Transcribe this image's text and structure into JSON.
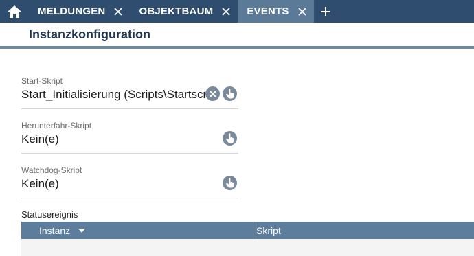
{
  "tabs": [
    {
      "label": "MELDUNGEN",
      "active": false
    },
    {
      "label": "OBJEKTBAUM",
      "active": false
    },
    {
      "label": "EVENTS",
      "active": true
    }
  ],
  "page_title": "Instanzkonfiguration",
  "fields": {
    "start": {
      "label": "Start-Skript",
      "value": "Start_Initialisierung (Scripts\\Startscript)"
    },
    "shutdown": {
      "label": "Herunterfahr-Skript",
      "value": "Kein(e)"
    },
    "watchdog": {
      "label": "Watchdog-Skript",
      "value": "Kein(e)"
    }
  },
  "status_section": {
    "label": "Statusereignis",
    "columns": [
      "Instanz",
      "Skript"
    ]
  },
  "icons": {
    "home": "home-icon",
    "tab_close": "close-icon",
    "add_tab": "plus-icon",
    "clear": "clear-circle-icon",
    "select": "pointing-hand-icon",
    "sort": "caret-down-icon"
  },
  "colors": {
    "tabbar": "#2f4e6f",
    "active_tab": "#5b7a98",
    "title": "#1e3652",
    "table_header": "#5d7d9c",
    "icon_button": "#7a8a9a"
  }
}
